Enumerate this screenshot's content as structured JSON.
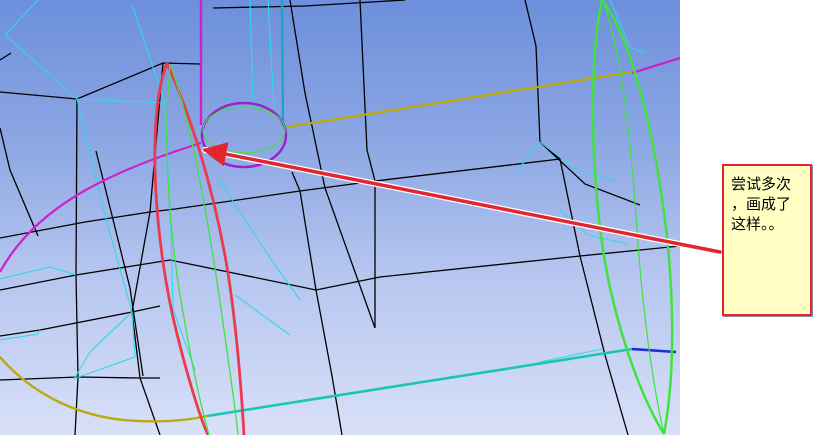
{
  "annotation": {
    "text": "尝试多次\n，画成了\n这样。。",
    "background": "#ffffc4",
    "border_color": "#e2252e"
  },
  "viewport": {
    "background_top": "#6d8fdc",
    "background_bottom": "#d9e0f8"
  },
  "colors": {
    "mesh_black": "#000000",
    "mesh_cyan": "#30d8e8",
    "curve_magenta": "#cc22cc",
    "circle_purple": "#9922cc",
    "curve_red": "#e83b4d",
    "curve_green": "#3fe23f",
    "curve_olive": "#b8ab12",
    "curve_teal": "#19c6b2",
    "curve_blue": "#1c2fd8",
    "arrow_red": "#e2252e"
  },
  "icons": {
    "arrow": "annotation-arrow-icon"
  }
}
